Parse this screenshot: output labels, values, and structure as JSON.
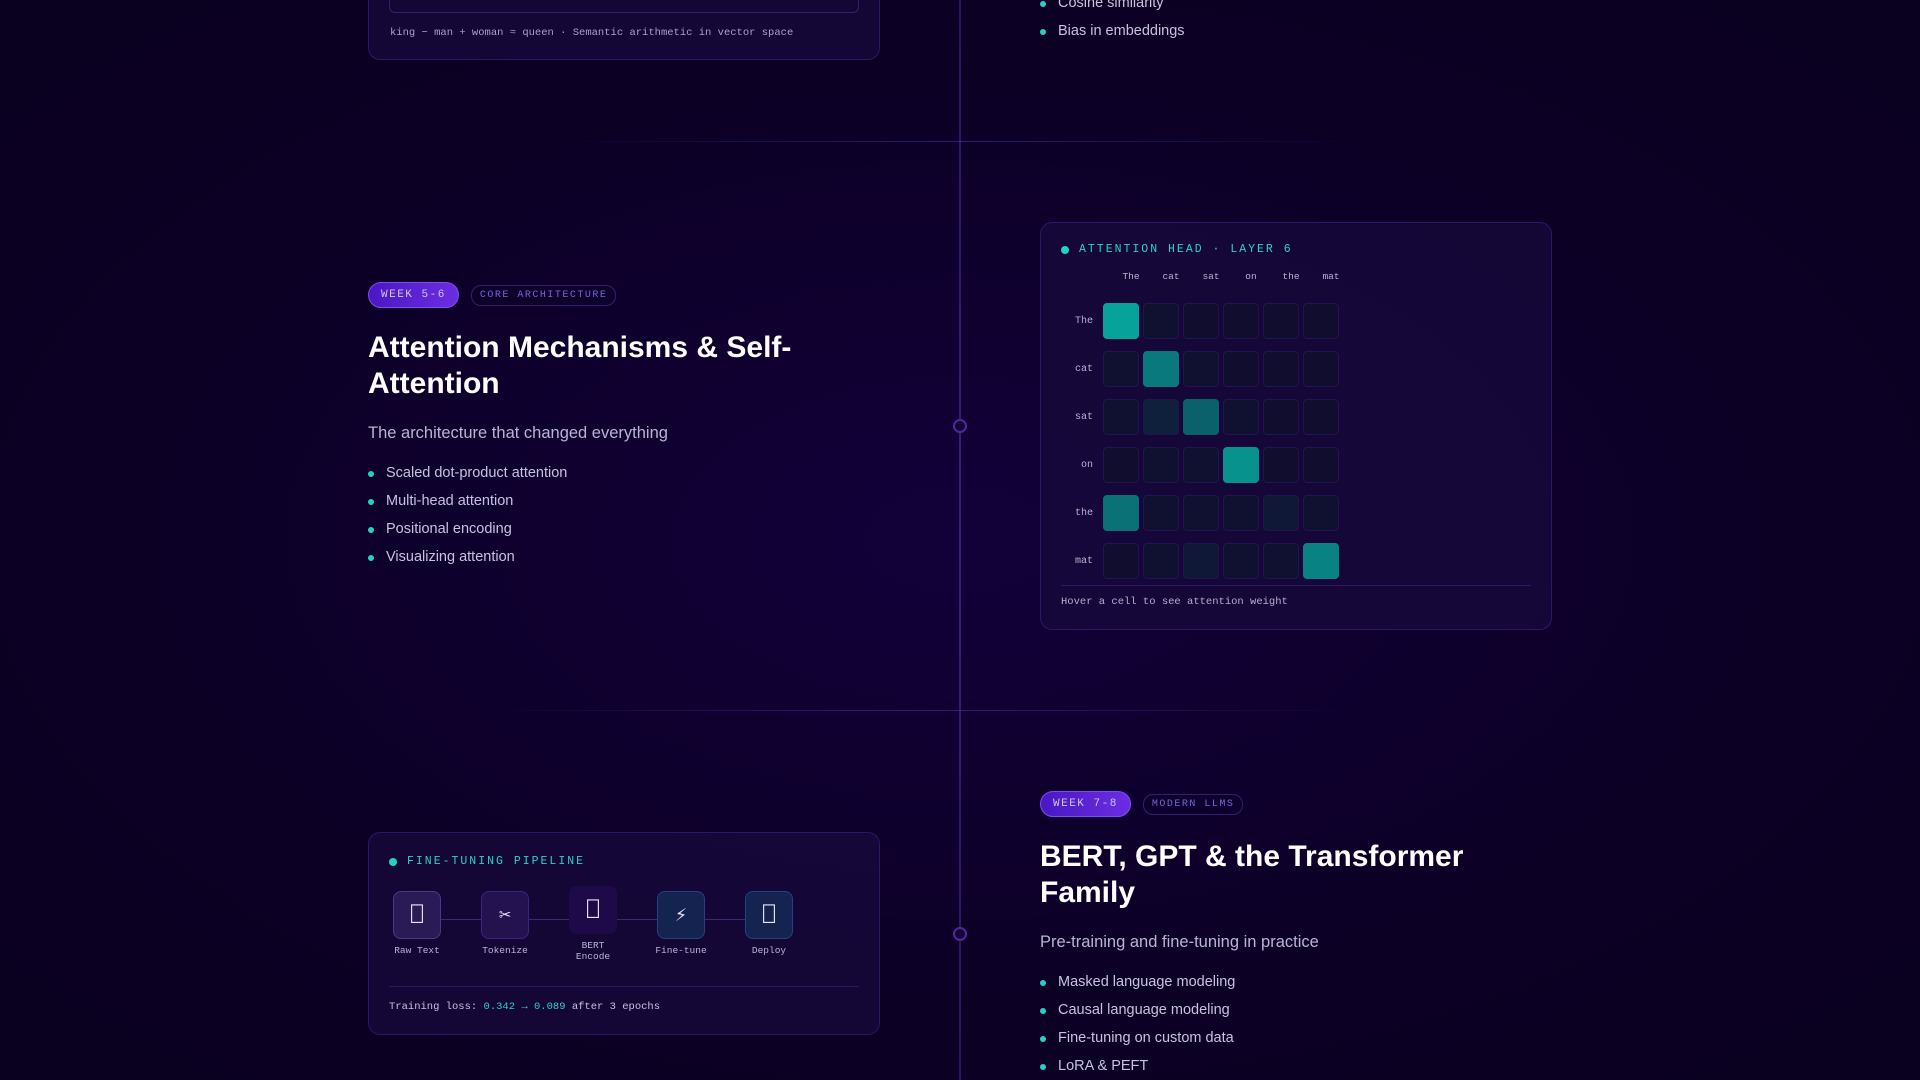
{
  "embedding_card": {
    "caption": "king − man + woman ≈ queen · Semantic arithmetic in vector space"
  },
  "prev_section": {
    "bullets": [
      "Cosine similarity",
      "Bias in embeddings"
    ]
  },
  "section_attention": {
    "week": "WEEK 5-6",
    "topic": "CORE ARCHITECTURE",
    "title": "Attention Mechanisms & Self-Attention",
    "subtitle": "The architecture that changed everything",
    "bullets": [
      "Scaled dot-product attention",
      "Multi-head attention",
      "Positional encoding",
      "Visualizing attention"
    ]
  },
  "attention_card": {
    "title": "ATTENTION HEAD · LAYER 6",
    "tokens": [
      "The",
      "cat",
      "sat",
      "on",
      "the",
      "mat"
    ],
    "weights": [
      [
        0.95,
        0.05,
        0.03,
        0.03,
        0.03,
        0.03
      ],
      [
        0.05,
        0.7,
        0.05,
        0.03,
        0.03,
        0.03
      ],
      [
        0.05,
        0.15,
        0.55,
        0.05,
        0.03,
        0.03
      ],
      [
        0.03,
        0.05,
        0.05,
        0.85,
        0.03,
        0.03
      ],
      [
        0.65,
        0.05,
        0.05,
        0.05,
        0.1,
        0.05
      ],
      [
        0.03,
        0.05,
        0.1,
        0.05,
        0.05,
        0.75
      ]
    ],
    "hint": "Hover a cell to see attention weight",
    "accent_color": "#22d3c5"
  },
  "pipeline_card": {
    "title": "FINE-TUNING PIPELINE",
    "steps": [
      {
        "label": "Raw Text",
        "icon": "document-icon",
        "glyph": "⎕",
        "bg": "#2a1a55",
        "border": "#4a3a80"
      },
      {
        "label": "Tokenize",
        "icon": "scissors-icon",
        "glyph": "✂",
        "bg": "#24114f",
        "border": "#3d2380"
      },
      {
        "label": "BERT Encode",
        "icon": "model-icon",
        "glyph": "⎕",
        "bg": "#1e0a48",
        "border": "#1e0a48"
      },
      {
        "label": "Fine-tune",
        "icon": "lightning-icon",
        "glyph": "⚡",
        "bg": "#152350",
        "border": "#264080"
      },
      {
        "label": "Deploy",
        "icon": "rocket-icon",
        "glyph": "⎕",
        "bg": "#152350",
        "border": "#264080"
      }
    ],
    "loss_prefix": "Training loss:",
    "loss_start": "0.342",
    "loss_arrow": "→",
    "loss_end": "0.089",
    "loss_suffix": "after 3 epochs"
  },
  "section_bert": {
    "week": "WEEK 7-8",
    "topic": "MODERN LLMS",
    "title": "BERT, GPT & the Transformer Family",
    "subtitle": "Pre-training and fine-tuning in practice",
    "bullets": [
      "Masked language modeling",
      "Causal language modeling",
      "Fine-tuning on custom data",
      "LoRA & PEFT"
    ]
  }
}
